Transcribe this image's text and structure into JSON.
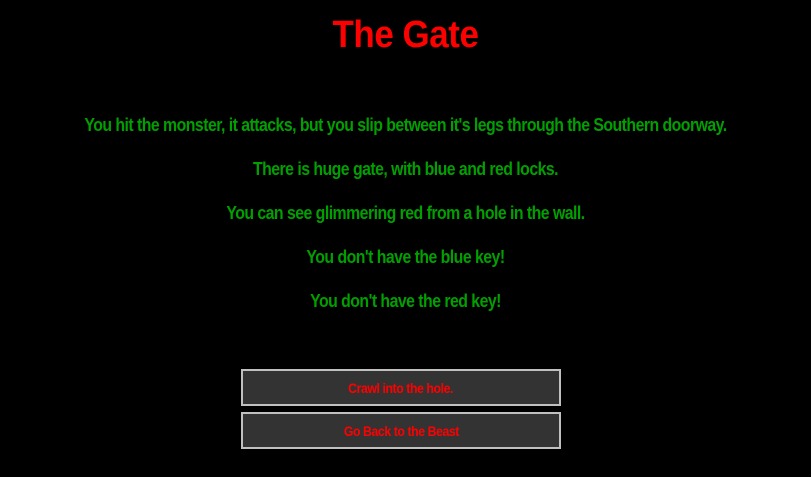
{
  "scene": {
    "title": "The Gate",
    "lines": [
      "You hit the monster, it attacks, but you slip between it's legs through the Southern doorway.",
      "There is huge gate, with blue and red locks.",
      "You can see glimmering red from a hole in the wall.",
      "You don't have the blue key!",
      "You don't have the red key!"
    ]
  },
  "choices": [
    {
      "label": "Crawl into the hole."
    },
    {
      "label": "Go Back to the Beast"
    }
  ],
  "colors": {
    "background": "#000000",
    "title": "#ff0000",
    "story_text": "#00a000",
    "button_bg": "#333333",
    "button_border": "#c0c0c0",
    "button_text": "#ff0000"
  }
}
